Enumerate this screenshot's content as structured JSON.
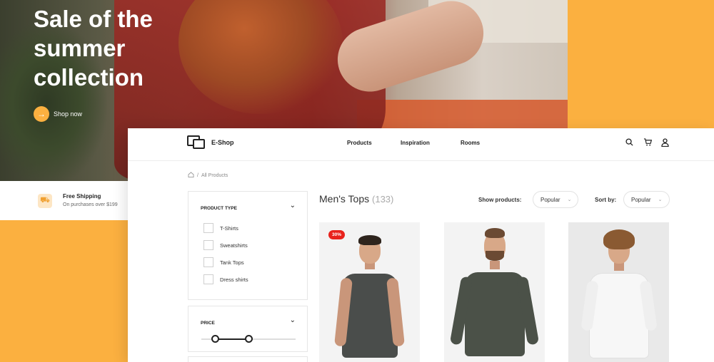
{
  "hero": {
    "title": "Sale of the summer collection",
    "cta_label": "Shop now",
    "cta_icon": "arrow-right-icon"
  },
  "shipping": {
    "title": "Free Shipping",
    "subtitle": "On purchases over $199",
    "icon": "truck-icon"
  },
  "shop": {
    "brand": "E-Shop",
    "menu": [
      "Products",
      "Inspiration",
      "Rooms"
    ],
    "icons": [
      "search-icon",
      "cart-icon",
      "user-icon"
    ],
    "breadcrumb": {
      "home_icon": "home-icon",
      "separator": "/",
      "current": "All Products"
    },
    "filters": {
      "product_type": {
        "title": "PRODUCT TYPE",
        "options": [
          "T-Shirts",
          "Sweatshirts",
          "Tank Tops",
          "Dress shirts"
        ]
      },
      "price": {
        "title": "PRICE",
        "range_low": 0.15,
        "range_high": 0.5
      }
    },
    "listing": {
      "title": "Men's Tops",
      "count": "(133)",
      "show_label": "Show products:",
      "show_value": "Popular",
      "sort_label": "Sort by:",
      "sort_value": "Popular"
    },
    "products": [
      {
        "badge": "30%",
        "shirt_color": "#4a4d4b"
      },
      {
        "badge": "",
        "shirt_color": "#4b5148"
      },
      {
        "badge": "",
        "shirt_color": "#f4f4f4"
      }
    ]
  },
  "colors": {
    "accent": "#fbb040",
    "sale": "#e8221c"
  }
}
